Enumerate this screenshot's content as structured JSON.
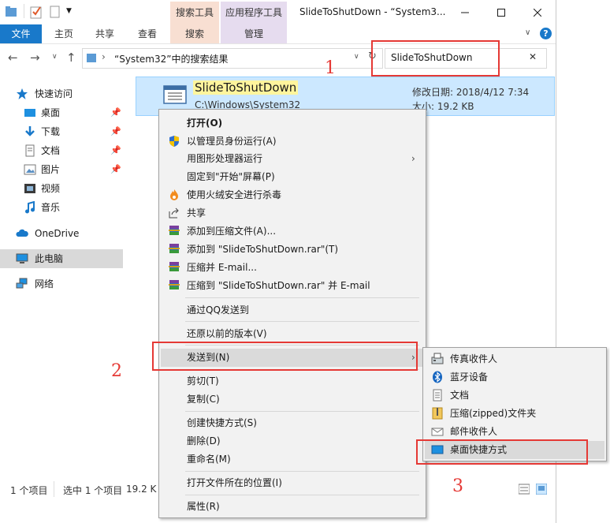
{
  "window": {
    "caption": "SlideToShutDown - “System3...",
    "minimize_icon": "minimize-icon",
    "maximize_icon": "maximize-icon",
    "close_icon": "close-icon"
  },
  "ribbon": {
    "tabs": [
      "文件",
      "主页",
      "共享",
      "查看"
    ],
    "context_tabs": [
      {
        "title": "搜索工具",
        "sub": "搜索",
        "color": "#f8dfd2"
      },
      {
        "title": "应用程序工具",
        "sub": "管理",
        "color": "#e6dcef"
      }
    ]
  },
  "address": {
    "path": "“System32”中的搜索结果",
    "search_value": "SlideToShutDown"
  },
  "nav": {
    "quick_access": "快速访问",
    "items": [
      "桌面",
      "下载",
      "文档",
      "图片",
      "视频",
      "音乐"
    ],
    "onedrive": "OneDrive",
    "this_pc": "此电脑",
    "network": "网络"
  },
  "file": {
    "name": "SlideToShutDown",
    "path": "C:\\Windows\\System32",
    "modified": "修改日期: 2018/4/12 7:34",
    "size": "大小: 19.2 KB"
  },
  "status": {
    "count": "1 个项目",
    "selected": "选中 1 个项目",
    "size": "19.2 K"
  },
  "context_menu": {
    "items": [
      {
        "label": "打开(O)",
        "icon": "",
        "bold": true
      },
      {
        "label": "以管理员身份运行(A)",
        "icon": "shield-icon"
      },
      {
        "label": "用图形处理器运行",
        "icon": "",
        "arrow": true
      },
      {
        "label": "固定到\"开始\"屏幕(P)",
        "icon": ""
      },
      {
        "label": "使用火绒安全进行杀毒",
        "icon": "huorong-icon"
      },
      {
        "label": "共享",
        "icon": "share-icon"
      },
      {
        "label": "添加到压缩文件(A)...",
        "icon": "winrar-icon"
      },
      {
        "label": "添加到 \"SlideToShutDown.rar\"(T)",
        "icon": "winrar-icon"
      },
      {
        "label": "压缩并 E-mail...",
        "icon": "winrar-icon"
      },
      {
        "label": "压缩到 \"SlideToShutDown.rar\" 并 E-mail",
        "icon": "winrar-icon"
      },
      {
        "label": "通过QQ发送到",
        "icon": ""
      },
      {
        "label": "还原以前的版本(V)",
        "icon": ""
      },
      {
        "label": "发送到(N)",
        "icon": "",
        "arrow": true,
        "highlighted": true
      },
      {
        "label": "剪切(T)",
        "icon": ""
      },
      {
        "label": "复制(C)",
        "icon": ""
      },
      {
        "label": "创建快捷方式(S)",
        "icon": ""
      },
      {
        "label": "删除(D)",
        "icon": ""
      },
      {
        "label": "重命名(M)",
        "icon": ""
      },
      {
        "label": "打开文件所在的位置(I)",
        "icon": ""
      },
      {
        "label": "属性(R)",
        "icon": ""
      }
    ]
  },
  "send_to_menu": {
    "items": [
      {
        "label": "传真收件人",
        "icon": "fax-icon"
      },
      {
        "label": "蓝牙设备",
        "icon": "bluetooth-icon"
      },
      {
        "label": "文档",
        "icon": "document-icon"
      },
      {
        "label": "压缩(zipped)文件夹",
        "icon": "zip-folder-icon"
      },
      {
        "label": "邮件收件人",
        "icon": "mail-icon"
      },
      {
        "label": "桌面快捷方式",
        "icon": "desktop-icon",
        "highlighted": true
      }
    ]
  },
  "annotations": {
    "step1": "1",
    "step2": "2",
    "step3": "3",
    "color": "#e53935"
  }
}
